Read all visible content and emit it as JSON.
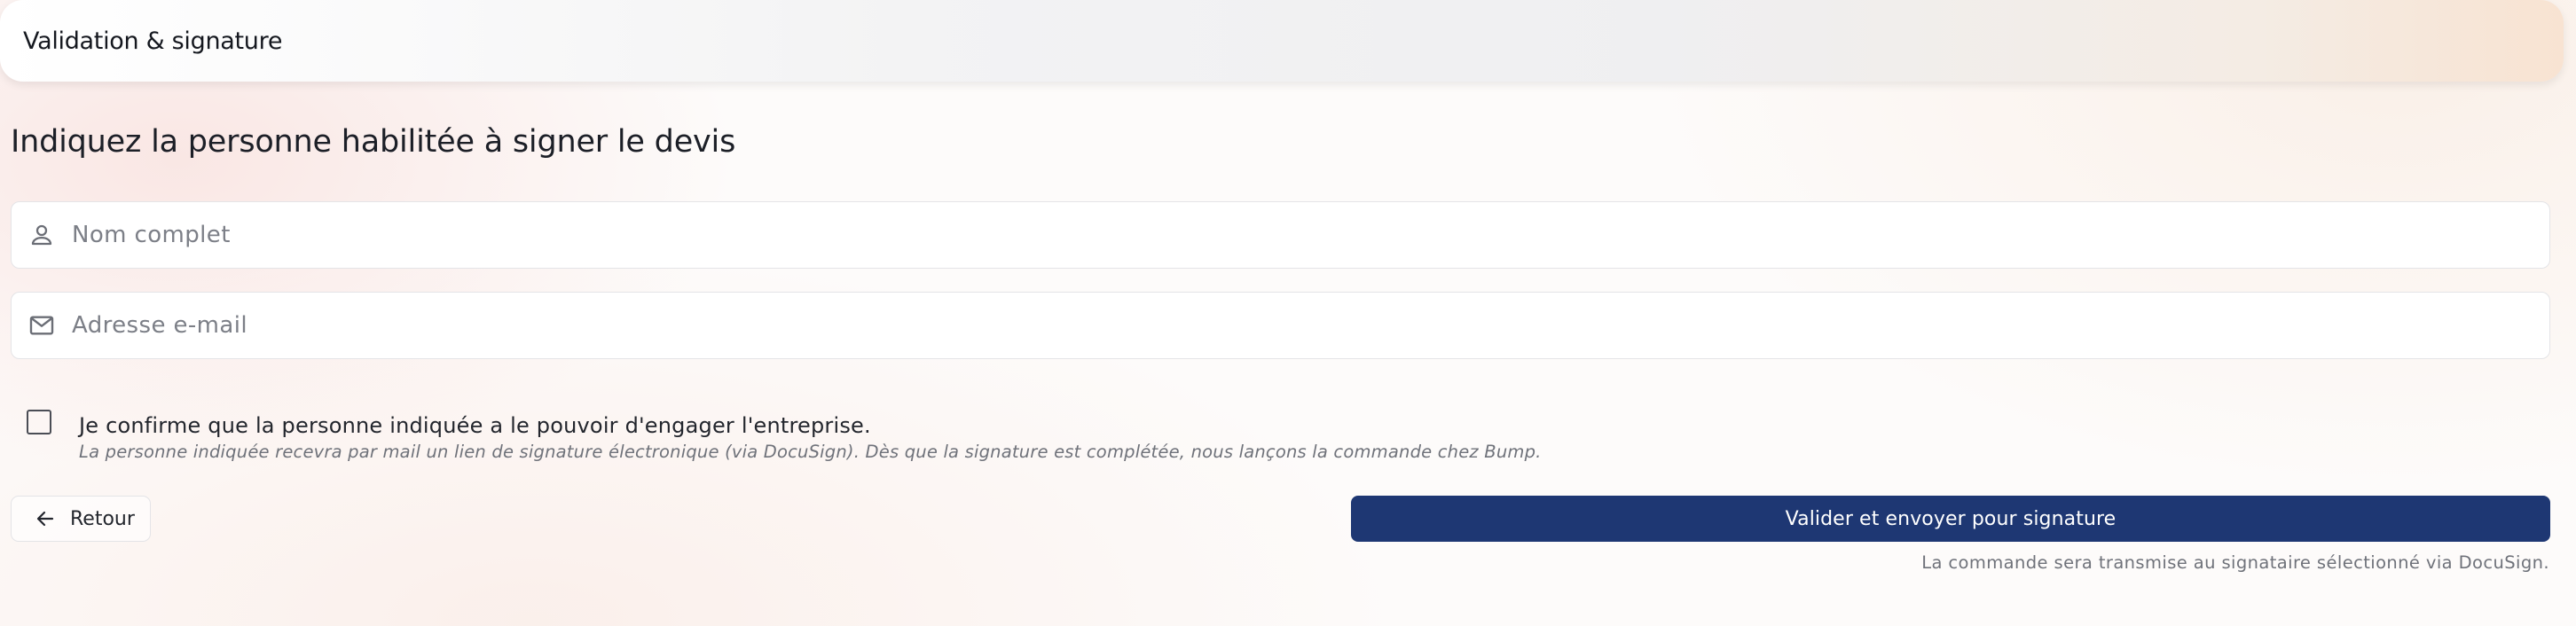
{
  "header": {
    "title": "Validation & signature"
  },
  "form": {
    "heading": "Indiquez la personne habilitée à signer le devis",
    "name_field": {
      "placeholder": "Nom complet",
      "value": "",
      "icon": "person-icon"
    },
    "email_field": {
      "placeholder": "Adresse e-mail",
      "value": "",
      "icon": "mail-icon"
    },
    "confirm": {
      "checked": false,
      "label": "Je confirme que la personne indiquée a le pouvoir d'engager l'entreprise.",
      "hint": "La personne indiquée recevra par mail un lien de signature électronique (via DocuSign). Dès que la signature est complétée, nous lançons la commande chez Bump."
    }
  },
  "actions": {
    "back_label": "Retour",
    "back_icon": "arrow-left-icon",
    "submit_label": "Valider et envoyer pour signature",
    "footer_note": "La commande sera transmise au signataire sélectionné via DocuSign."
  },
  "colors": {
    "primary": "#1e3773",
    "border": "#e4e4e7",
    "muted_text": "#6f727a"
  }
}
